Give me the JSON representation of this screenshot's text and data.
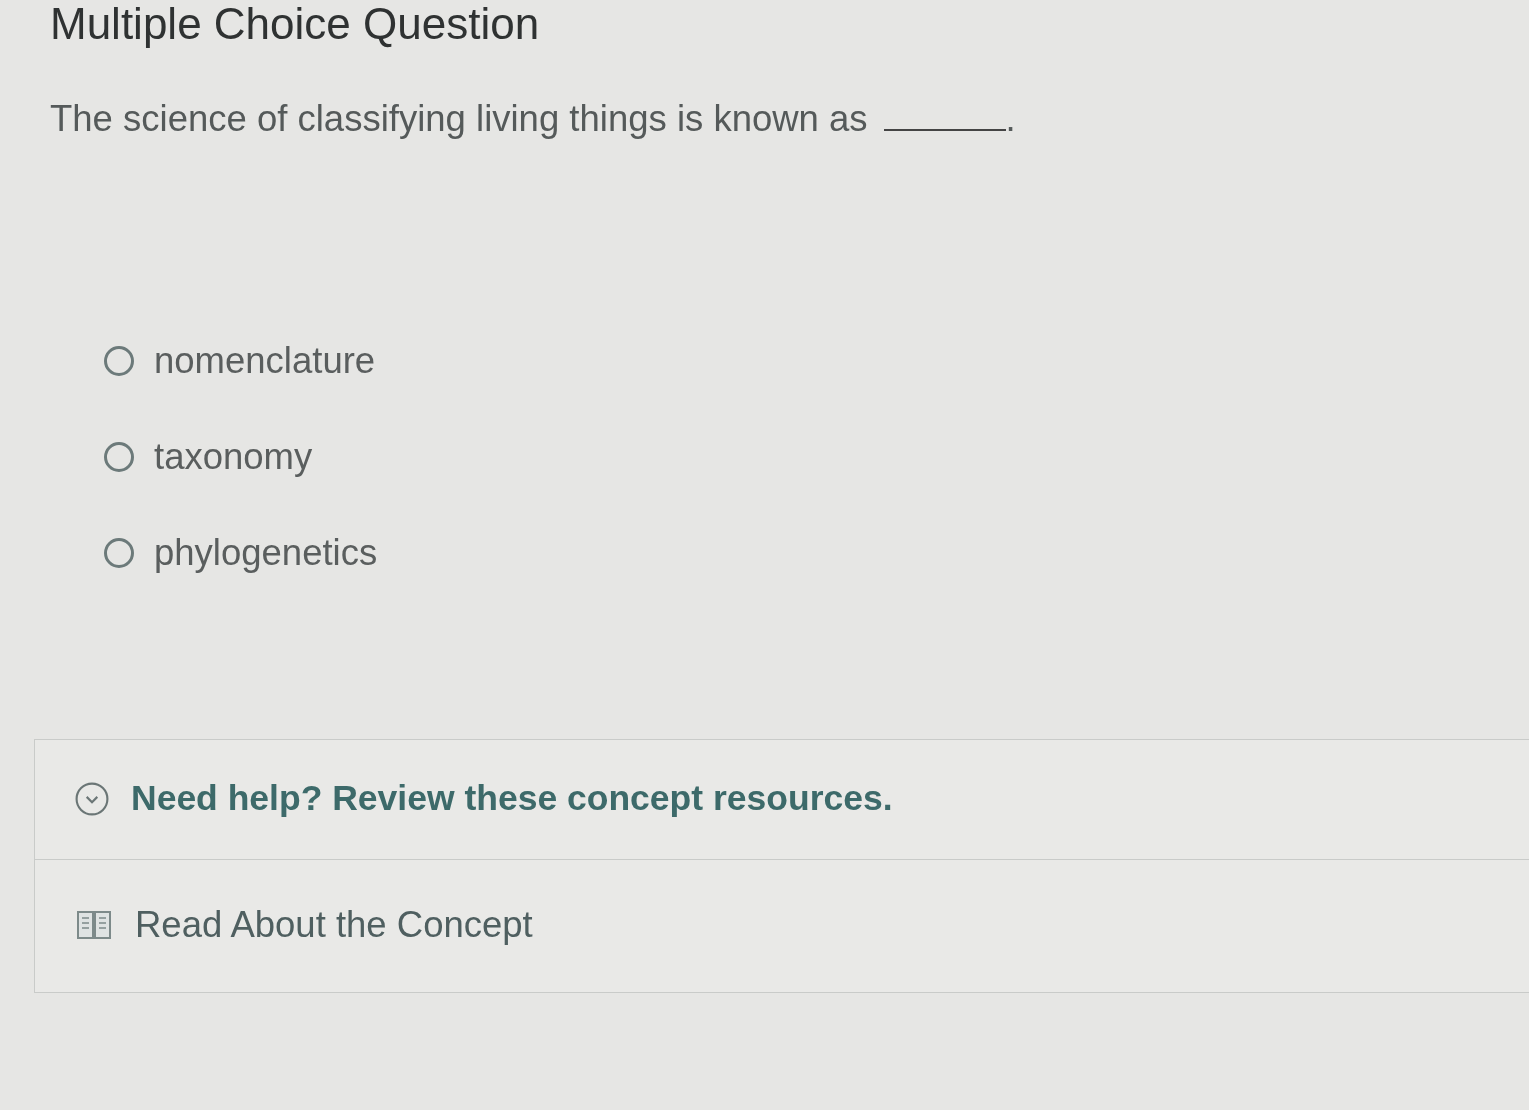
{
  "title": "Multiple Choice Question",
  "question": {
    "text": "The science of classifying living things is known as",
    "after_blank": "."
  },
  "options": [
    {
      "label": "nomenclature",
      "selected": false
    },
    {
      "label": "taxonomy",
      "selected": false
    },
    {
      "label": "phylogenetics",
      "selected": false
    }
  ],
  "help": {
    "heading": "Need help? Review these concept resources.",
    "expanded": true,
    "resources": [
      {
        "label": "Read About the Concept",
        "kind": "reading"
      }
    ]
  }
}
